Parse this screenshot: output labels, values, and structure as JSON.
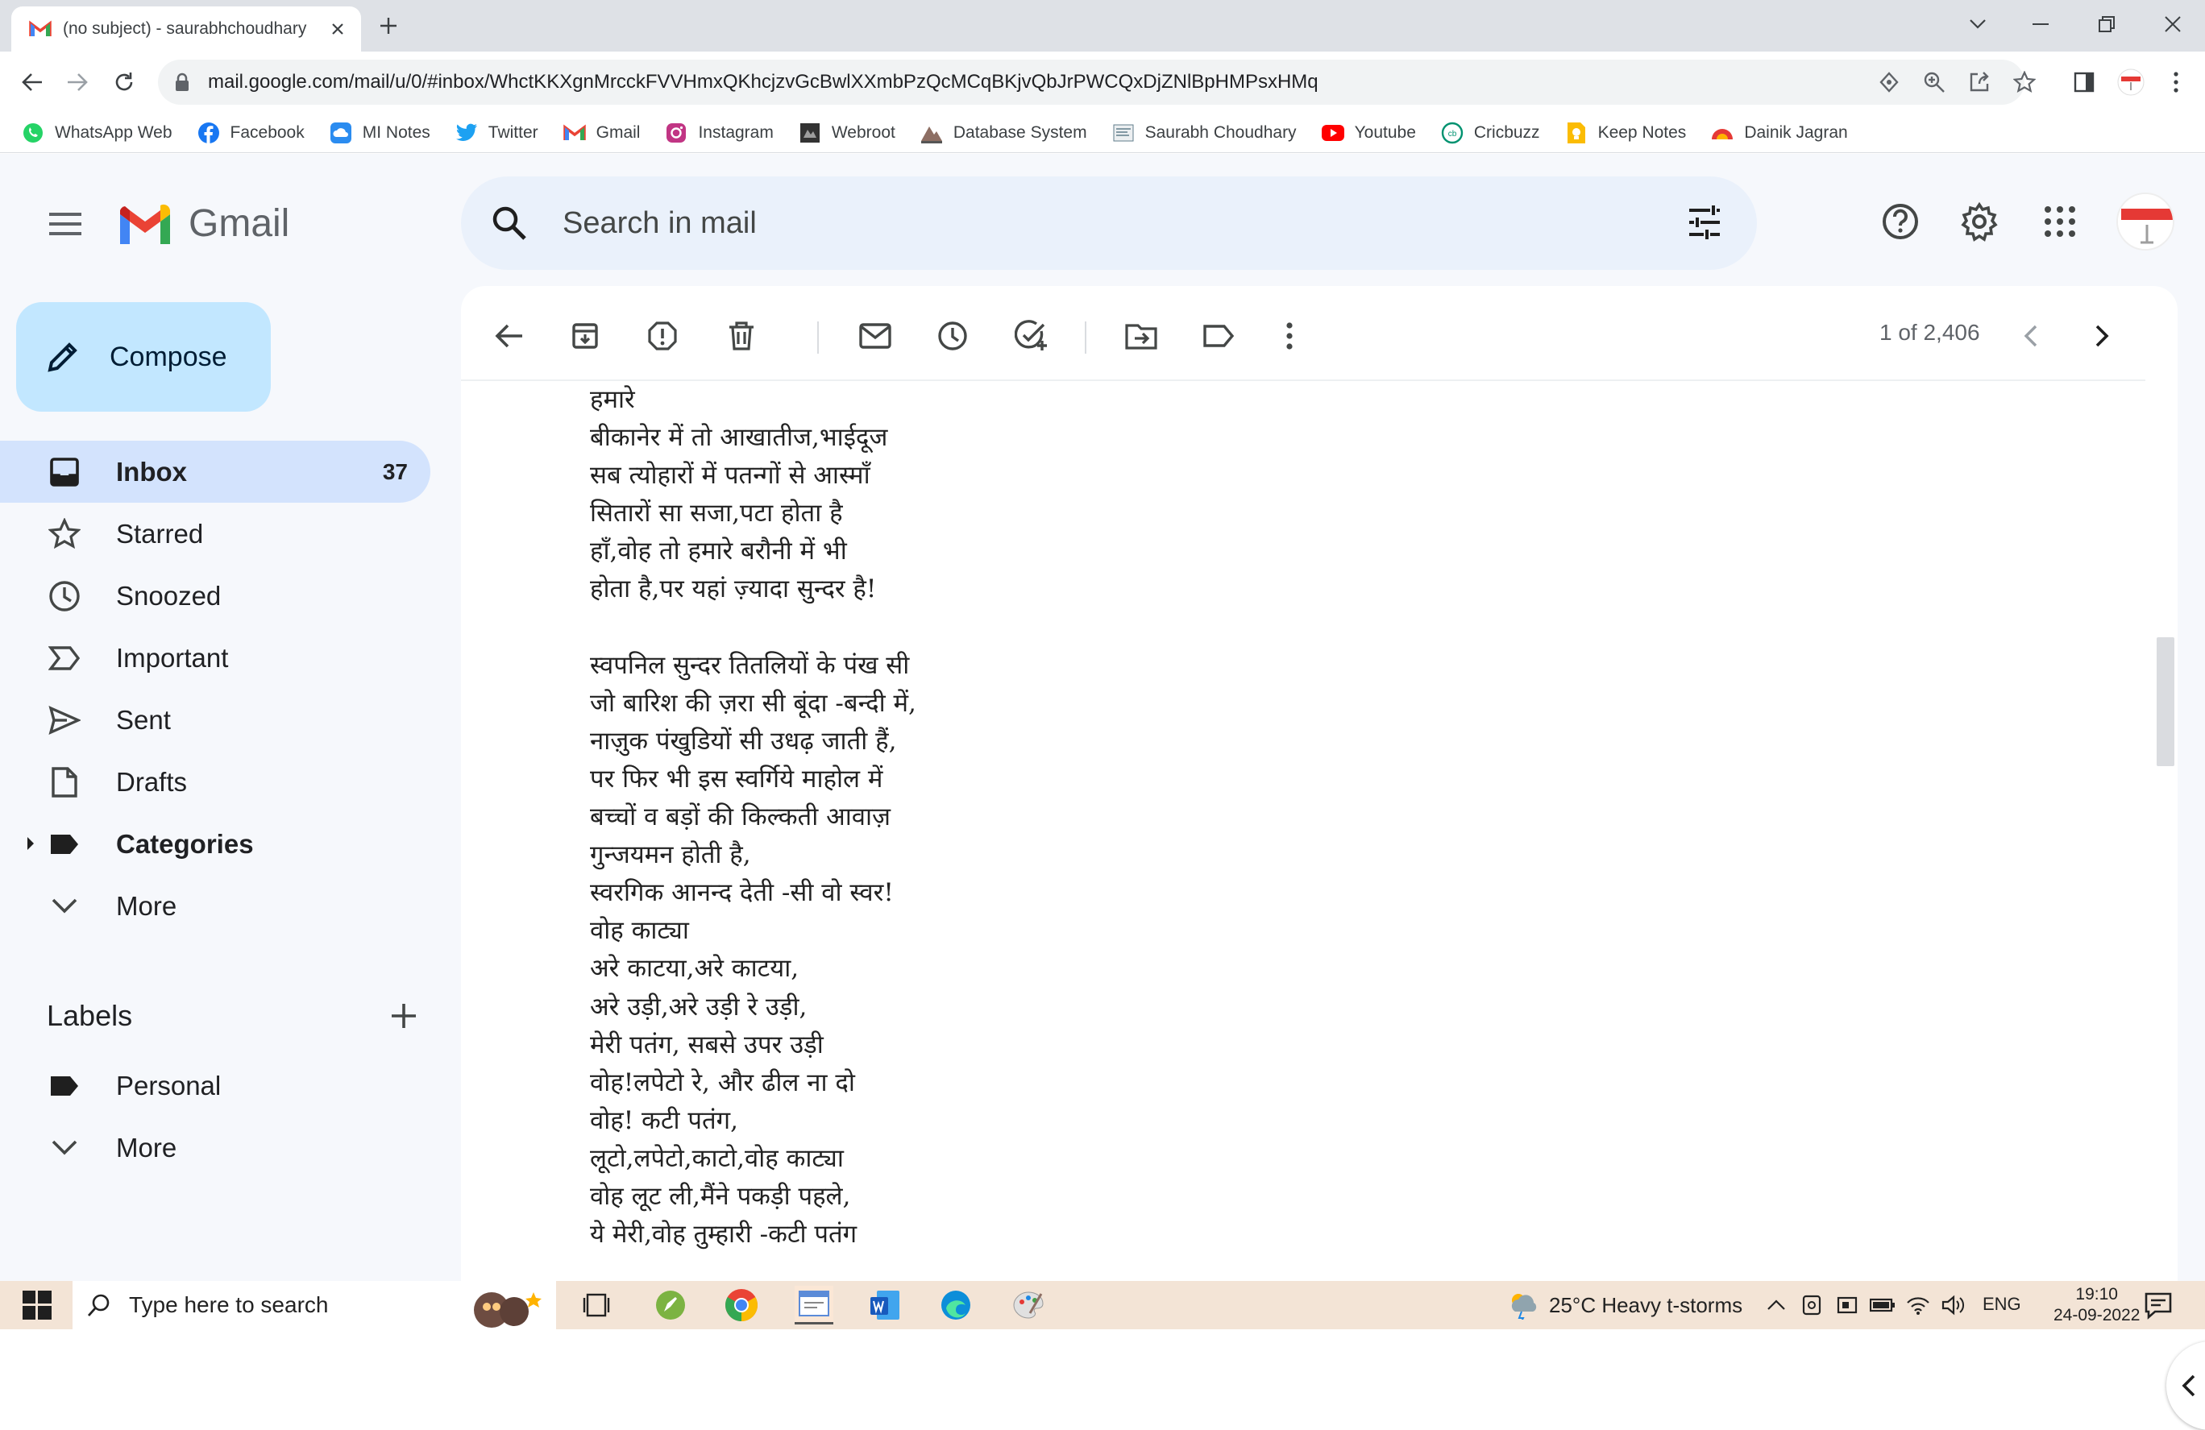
{
  "browser": {
    "tab_title": "(no subject) - saurabhchoudhary",
    "url": "mail.google.com/mail/u/0/#inbox/WhctKKXgnMrcckFVVHmxQKhcjzvGcBwlXXmbPzQcMCqBKjvQbJrPWCQxDjZNlBpHMPsxHMq",
    "bookmarks": [
      {
        "label": "WhatsApp Web",
        "icon": "whatsapp-icon",
        "color": "#25d366"
      },
      {
        "label": "Facebook",
        "icon": "facebook-icon",
        "color": "#1877f2"
      },
      {
        "label": "MI Notes",
        "icon": "cloud-icon",
        "color": "#2b8cf0"
      },
      {
        "label": "Twitter",
        "icon": "twitter-icon",
        "color": "#1da1f2"
      },
      {
        "label": "Gmail",
        "icon": "gmail-icon",
        "color": "#ea4335"
      },
      {
        "label": "Instagram",
        "icon": "instagram-icon",
        "color": "#c13584"
      },
      {
        "label": "Webroot",
        "icon": "webroot-icon",
        "color": "#333333"
      },
      {
        "label": "Database System",
        "icon": "database-icon",
        "color": "#8d6e63"
      },
      {
        "label": "Saurabh Choudhary",
        "icon": "page-icon",
        "color": "#607d8b"
      },
      {
        "label": "Youtube",
        "icon": "youtube-icon",
        "color": "#ff0000"
      },
      {
        "label": "Cricbuzz",
        "icon": "cricbuzz-icon",
        "color": "#009270"
      },
      {
        "label": "Keep Notes",
        "icon": "keep-icon",
        "color": "#fbbc04"
      },
      {
        "label": "Dainik Jagran",
        "icon": "jagran-icon",
        "color": "#e53935"
      }
    ]
  },
  "gmail": {
    "logo_text": "Gmail",
    "search_placeholder": "Search in mail",
    "compose_label": "Compose",
    "nav": [
      {
        "label": "Inbox",
        "count": "37",
        "icon": "inbox-icon",
        "active": true
      },
      {
        "label": "Starred",
        "icon": "star-icon"
      },
      {
        "label": "Snoozed",
        "icon": "clock-icon"
      },
      {
        "label": "Important",
        "icon": "important-icon"
      },
      {
        "label": "Sent",
        "icon": "send-icon"
      },
      {
        "label": "Drafts",
        "icon": "draft-icon"
      },
      {
        "label": "Categories",
        "icon": "label-icon"
      },
      {
        "label": "More",
        "icon": "chevron-down-icon"
      }
    ],
    "labels_title": "Labels",
    "labels": [
      {
        "label": "Personal",
        "icon": "label-icon"
      },
      {
        "label": "More",
        "icon": "chevron-down-icon"
      }
    ],
    "pager": "1 of 2,406",
    "body_lines": [
      " हमारे",
      "बीकानेर में तो आखातीज,भाईदूज",
      "सब त्योहारों में पतन्गों से आस्माँ",
      "सितारों सा सजा,पटा होता है",
      "हाँ,वोह तो हमारे बरौनी में भी",
      "होता है,पर यहां ज़्यादा सुन्दर है!",
      "",
      "स्वपनिल सुन्दर तितलियों के  पंख सी",
      "जो बारिश की ज़रा सी बूंदा -बन्दी में,",
      "नाज़ुक पंखुडियों सी उधढ़ जाती हैं,",
      "पर फिर भी  इस स्वर्गिये माहोल में",
      "बच्चों व बड़ों की किल्कती आवाज़",
      "गुन्जयमन होती है,",
      "स्वरगिक आनन्द देती -सी वो स्वर!",
      " वोह काट्या",
      "अरे काटया,अरे काटया,",
      "अरे उड़ी,अरे उड़ी रे उड़ी,",
      "मेरी पतंग, सबसे उपर उड़ी",
      "वोह!लपेटो रे, और ढील ना दो",
      "वोह! कटी पतंग,",
      "लूटो,लपेटो,काटो,वोह काट्या",
      "वोह लूट ली,मैंने पकड़ी पहले,",
      "ये मेरी,वोह तुम्हारी -कटी पतंग"
    ]
  },
  "taskbar": {
    "search_placeholder": "Type here to search",
    "weather": "25°C  Heavy t-storms",
    "lang": "ENG",
    "time": "19:10",
    "date": "24-09-2022"
  },
  "colors": {
    "accent": "#0b57d0",
    "compose_bg": "#c2e7ff",
    "active_nav": "#d3e3fd",
    "app_bg": "#f6f8fc"
  }
}
